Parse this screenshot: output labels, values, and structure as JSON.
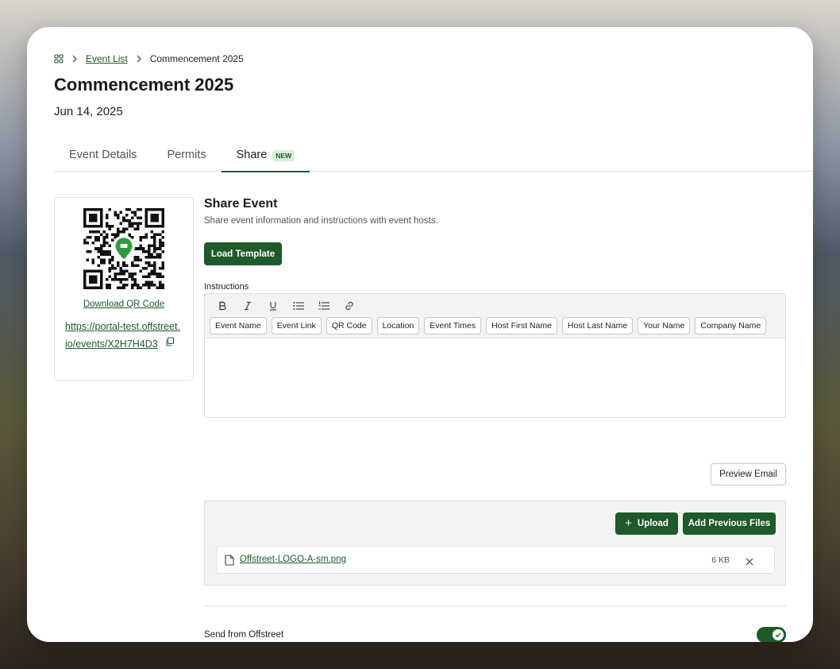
{
  "breadcrumb": {
    "home_icon": "grid-icon",
    "parent": "Event List",
    "current": "Commencement 2025"
  },
  "event": {
    "title": "Commencement 2025",
    "date": "Jun 14, 2025"
  },
  "tabs": [
    {
      "label": "Event Details",
      "active": false
    },
    {
      "label": "Permits",
      "active": false
    },
    {
      "label": "Share",
      "active": true,
      "badge": "NEW"
    }
  ],
  "qr_panel": {
    "download_label": "Download QR Code",
    "url": "https://portal-test.offstreet.io/events/X2H7H4D3",
    "copy_icon": "copy-icon",
    "center_icon": "car-pin-icon"
  },
  "share": {
    "title": "Share Event",
    "subtitle": "Share event information and instructions with event hosts.",
    "load_template_label": "Load Template",
    "instructions_label": "Instructions",
    "format_buttons": [
      "bold-icon",
      "italic-icon",
      "underline-icon",
      "bullet-list-icon",
      "numbered-list-icon",
      "link-icon"
    ],
    "tokens": [
      "Event Name",
      "Event Link",
      "QR Code",
      "Location",
      "Event Times",
      "Host First Name",
      "Host Last Name",
      "Your Name",
      "Company Name"
    ],
    "editor_value": "",
    "preview_email_label": "Preview Email",
    "upload_label": "Upload",
    "add_previous_files_label": "Add Previous Files",
    "files": [
      {
        "name": "Offstreet-LOGO-A-sm.png",
        "size": "6 KB"
      }
    ],
    "send_from_label": "Send from Offstreet",
    "send_from_enabled": true
  },
  "colors": {
    "accent": "#1e5a2a",
    "badge_bg": "#d7f0d9",
    "toolbar_bg": "#f3f3f3",
    "qr_pin": "#2f9a41"
  }
}
